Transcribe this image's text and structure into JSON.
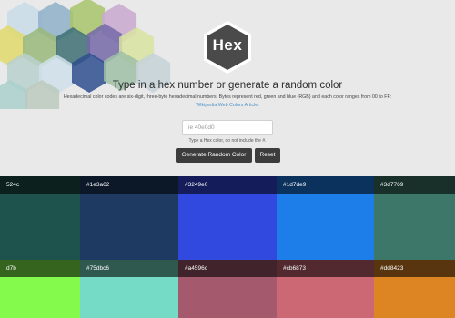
{
  "logo": {
    "text": "Hex"
  },
  "headline": "Type in a hex number or generate a random color",
  "description": "Hexadecimal color codes are six-digit, three-byte hexadecimal numbers. Bytes represent red, green and blue (RGB) and each color ranges from 00 to FF:",
  "link_text": "Wikipedia Web Colors Article.",
  "input": {
    "placeholder": "ie 40e0d0",
    "value": ""
  },
  "hint": "Type a Hex color, do not include the #.",
  "buttons": {
    "generate": "Generate Random Color",
    "reset": "Reset"
  },
  "colors": {
    "row1": [
      {
        "label": "524c",
        "hex": "#1e524c"
      },
      {
        "label": "#1e3a62",
        "hex": "#1e3a62"
      },
      {
        "label": "#3249e0",
        "hex": "#3249e0"
      },
      {
        "label": "#1d7de9",
        "hex": "#1d7de9"
      },
      {
        "label": "#3d7769",
        "hex": "#3d7769"
      }
    ],
    "row2": [
      {
        "label": "d7b",
        "hex": "#84fa4d"
      },
      {
        "label": "#75dbc6",
        "hex": "#75dbc6"
      },
      {
        "label": "#a4596c",
        "hex": "#a4596c"
      },
      {
        "label": "#cb6873",
        "hex": "#cb6873"
      },
      {
        "label": "#dd8423",
        "hex": "#dd8423"
      }
    ]
  },
  "decor_hex_colors": [
    "#c9dce8",
    "#8fb0c9",
    "#a8c46a",
    "#c9a8d0",
    "#e0d96b",
    "#9ab87a",
    "#3d6e72",
    "#7468a8",
    "#d8e3a0",
    "#b9d0cc",
    "#cfe0ea",
    "#2e4f8e",
    "#9fc0a7",
    "#c6d2d8",
    "#a9d0cb",
    "#bcc9be"
  ]
}
